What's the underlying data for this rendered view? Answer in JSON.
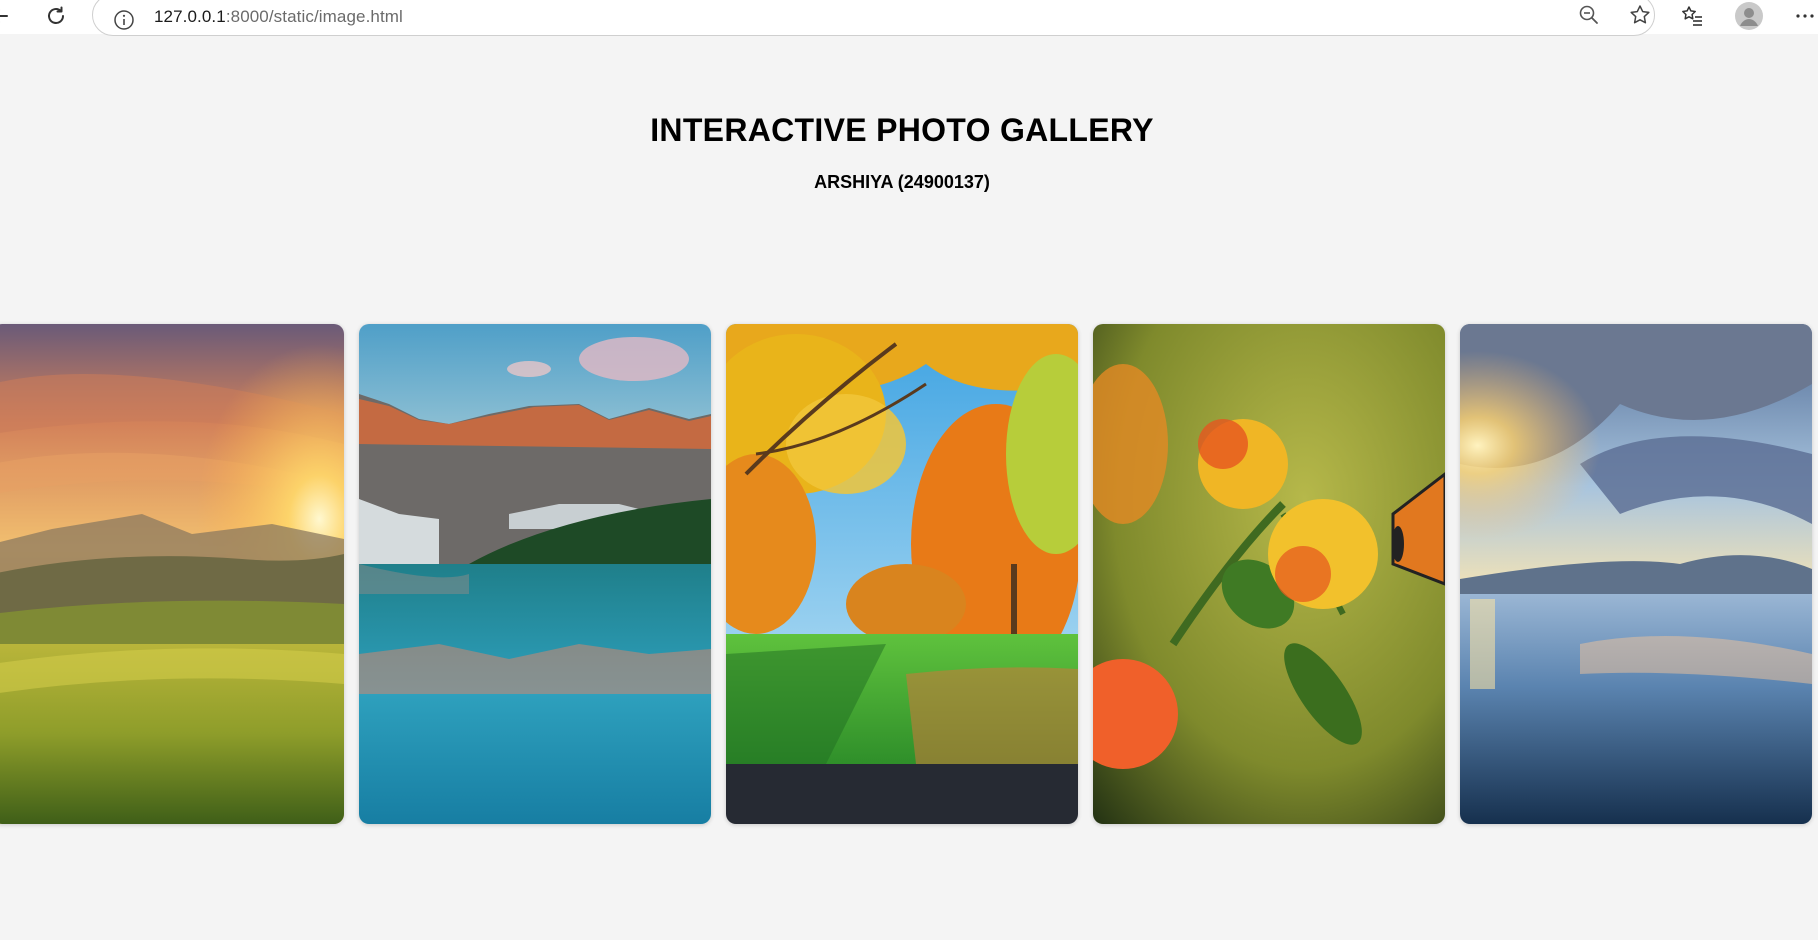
{
  "browser": {
    "url_host": "127.0.0.1",
    "url_rest": ":8000/static/image.html",
    "icons": [
      "back-icon",
      "refresh-icon",
      "info-icon",
      "zoom-out-icon",
      "favorite-star-icon",
      "favorites-list-icon",
      "profile-avatar-icon",
      "more-menu-icon"
    ]
  },
  "page": {
    "title": "INTERACTIVE PHOTO GALLERY",
    "subtitle": "ARSHIYA (24900137)"
  },
  "gallery": {
    "images": [
      {
        "subject": "mountain-sunset-meadow"
      },
      {
        "subject": "mountain-lake-reflection"
      },
      {
        "subject": "autumn-trees-park"
      },
      {
        "subject": "butterfly-on-flowers"
      },
      {
        "subject": "sunset-lake-clouds"
      }
    ]
  }
}
